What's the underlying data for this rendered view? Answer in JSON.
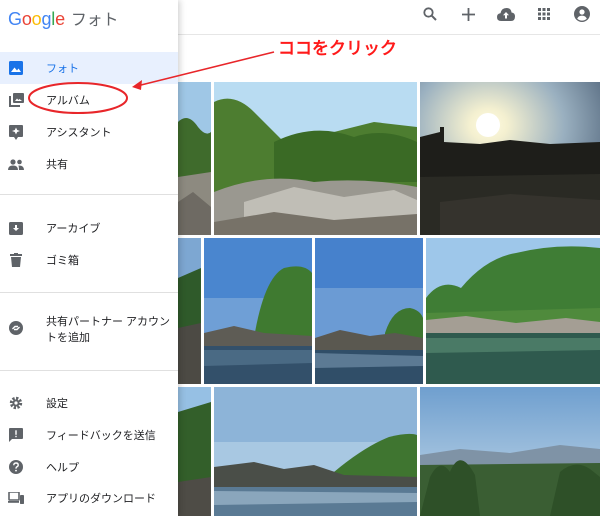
{
  "app": {
    "logo_parts": [
      "G",
      "o",
      "o",
      "g",
      "l",
      "e"
    ],
    "product_name": "フォト"
  },
  "sidebar": {
    "items": [
      {
        "label": "フォト",
        "icon": "photo-icon",
        "active": true
      },
      {
        "label": "アルバム",
        "icon": "album-icon"
      },
      {
        "label": "アシスタント",
        "icon": "assistant-icon"
      },
      {
        "label": "共有",
        "icon": "people-icon"
      },
      {
        "label": "アーカイブ",
        "icon": "archive-icon"
      },
      {
        "label": "ゴミ箱",
        "icon": "trash-icon"
      },
      {
        "label": "共有パートナー アカウントを追加",
        "icon": "partner-sharing-icon"
      },
      {
        "label": "設定",
        "icon": "gear-icon"
      },
      {
        "label": "フィードバックを送信",
        "icon": "feedback-icon"
      },
      {
        "label": "ヘルプ",
        "icon": "help-icon"
      },
      {
        "label": "アプリのダウンロード",
        "icon": "devices-icon"
      }
    ]
  },
  "topbar": {
    "icons": [
      "search-icon",
      "add-icon",
      "upload-icon",
      "apps-icon",
      "account-icon"
    ]
  },
  "annotation": {
    "text": "ココをクリック",
    "color": "#ff1a1a"
  },
  "colors": {
    "accent": "#1a73e8",
    "active_bg": "#e8f0fe",
    "annotation_red": "#e8262a"
  }
}
